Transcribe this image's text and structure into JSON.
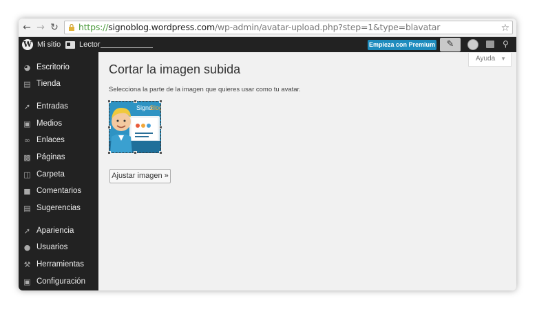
{
  "browser": {
    "url_scheme": "https://",
    "url_host": "signoblog.wordpress.com",
    "url_path": "/wp-admin/avatar-upload.php?step=1&type=blavatar",
    "back_icon": "back-arrow-icon",
    "forward_icon": "forward-arrow-icon",
    "reload_icon": "reload-icon"
  },
  "adminbar": {
    "my_site": "Mi sitio",
    "reader": "Lector",
    "premium": "Empieza con Premium"
  },
  "sidebar": {
    "items": [
      {
        "label": "Escritorio",
        "icon": "dashboard-icon"
      },
      {
        "label": "Tienda",
        "icon": "cart-icon"
      },
      {
        "label": "Entradas",
        "icon": "pin-icon"
      },
      {
        "label": "Medios",
        "icon": "media-icon"
      },
      {
        "label": "Enlaces",
        "icon": "link-icon"
      },
      {
        "label": "Páginas",
        "icon": "pages-icon"
      },
      {
        "label": "Carpeta",
        "icon": "folder-icon"
      },
      {
        "label": "Comentarios",
        "icon": "comment-icon"
      },
      {
        "label": "Sugerencias",
        "icon": "feedback-icon"
      },
      {
        "label": "Apariencia",
        "icon": "appearance-icon"
      },
      {
        "label": "Usuarios",
        "icon": "users-icon"
      },
      {
        "label": "Herramientas",
        "icon": "tools-icon"
      },
      {
        "label": "Configuración",
        "icon": "settings-icon"
      }
    ]
  },
  "main": {
    "help": "Ayuda",
    "title": "Cortar la imagen subida",
    "description": "Selecciona la parte de la imagen que quieres usar como tu avatar.",
    "logo_text_a": "Signo",
    "logo_text_b": "Blog",
    "adjust_button": "Ajustar imagen »"
  },
  "colors": {
    "adminbar": "#222222",
    "premium": "#1e8cbe",
    "content_bg": "#f1f1f1"
  }
}
